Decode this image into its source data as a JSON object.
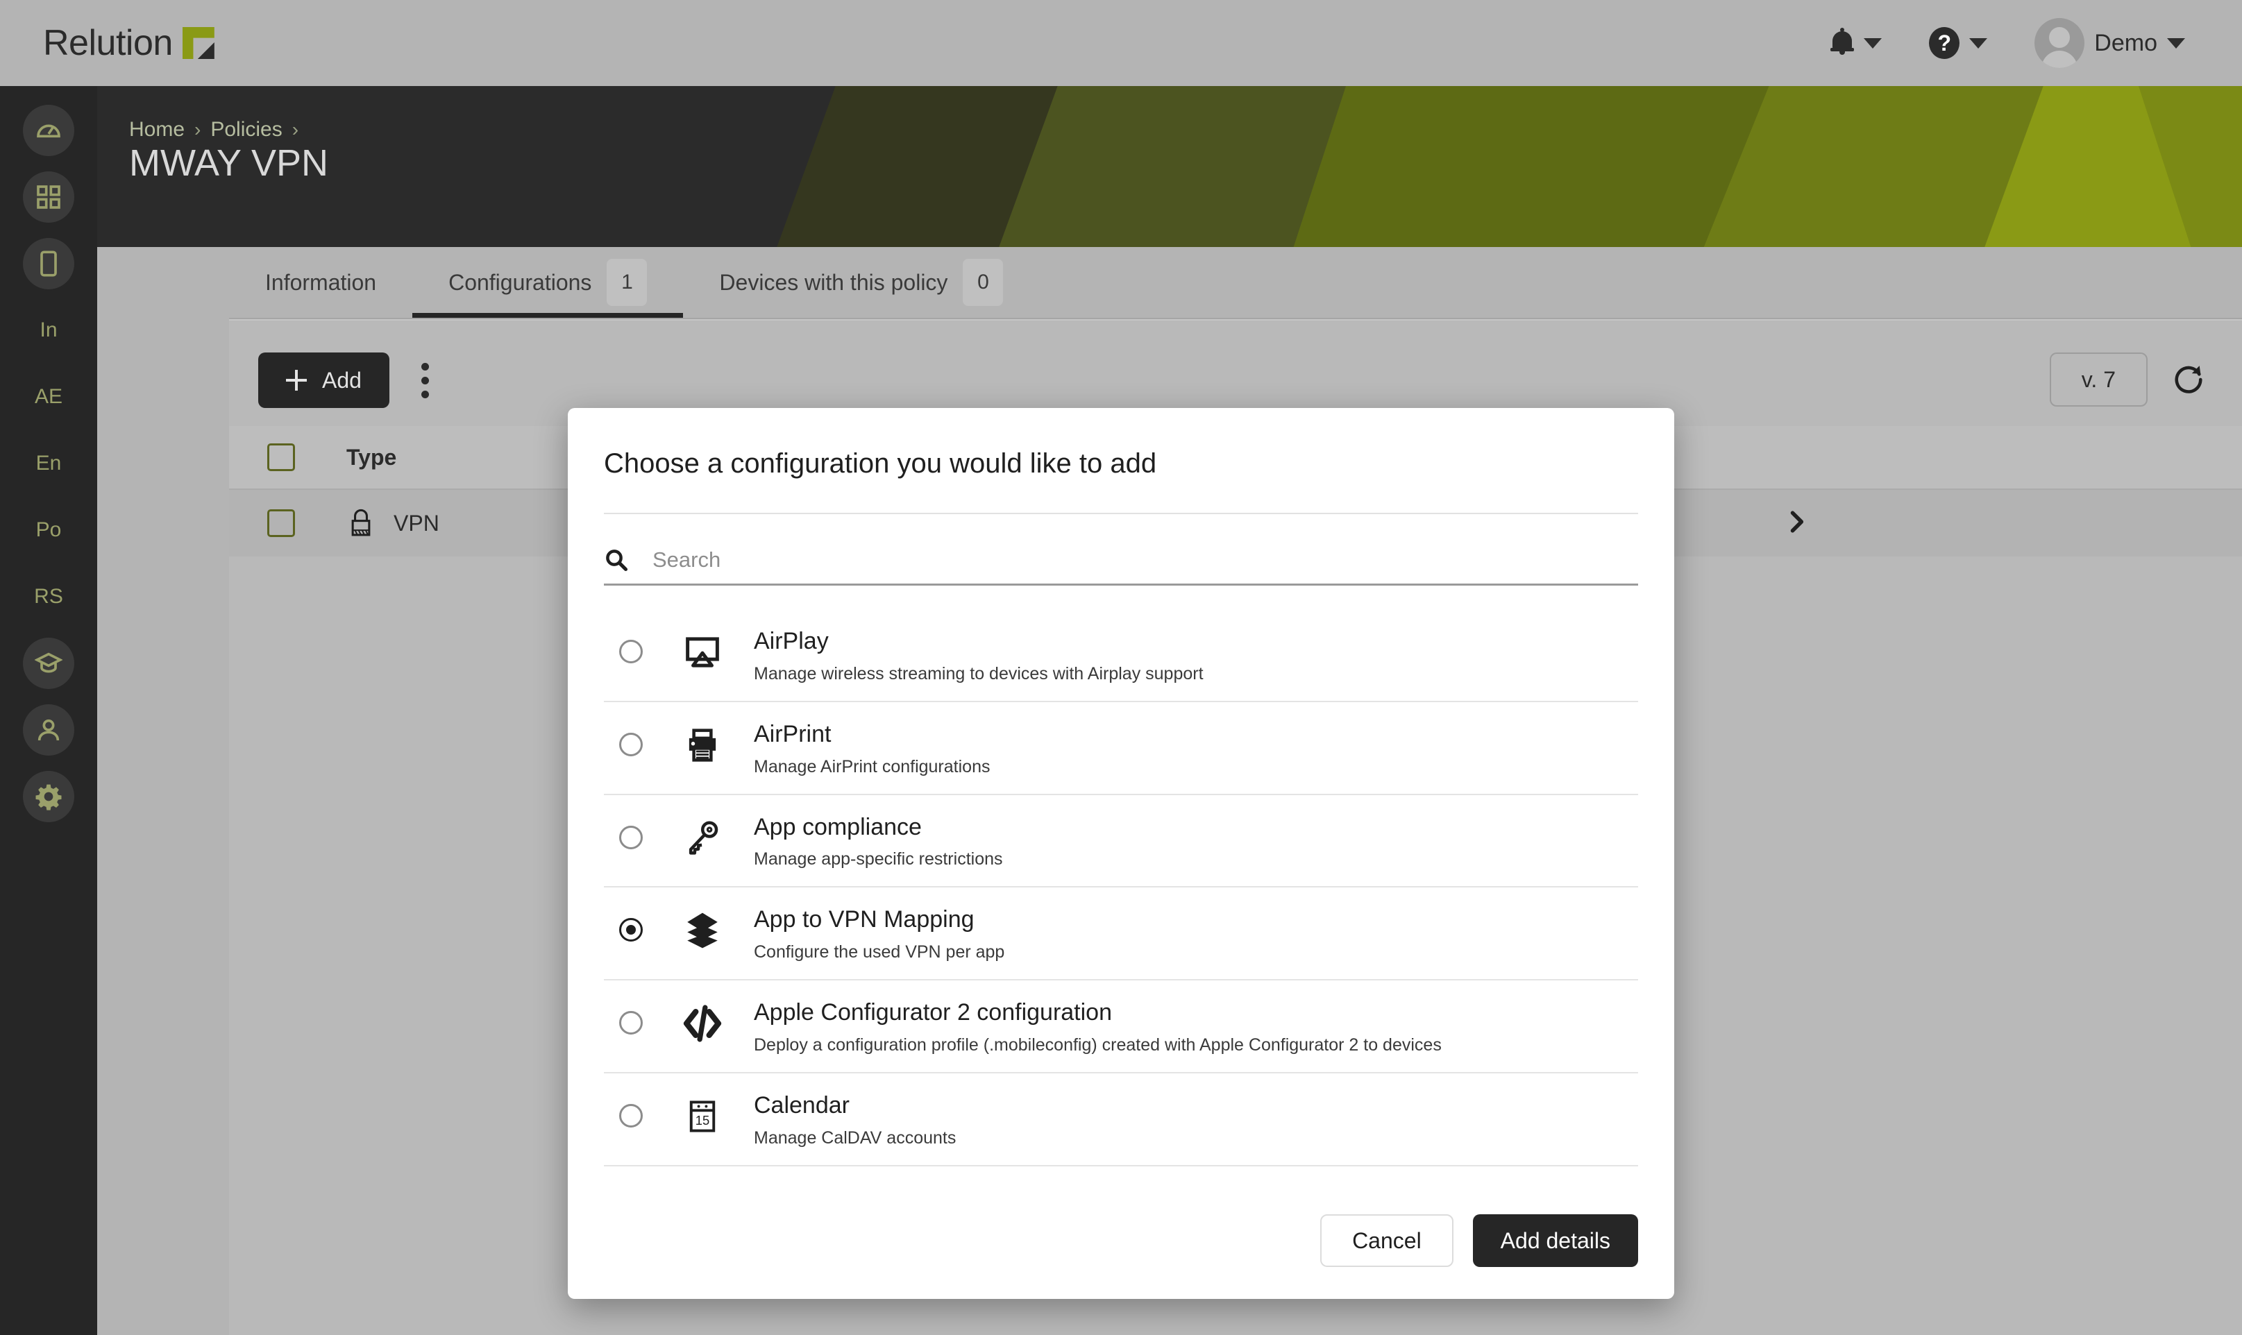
{
  "brand": {
    "name": "Relution",
    "accent_color": "#8a9a15",
    "dark_color": "#262626"
  },
  "topbar": {
    "notifications_icon": "bell-icon",
    "help_icon": "help-icon",
    "avatar_icon": "avatar",
    "user_name": "Demo",
    "chevron_icon": "chevron-down-icon"
  },
  "sidebar": {
    "items": [
      {
        "icon": "dashboard-gauge-icon",
        "label": "",
        "active": true
      },
      {
        "icon": "apps-grid-icon",
        "label": "",
        "active": true
      },
      {
        "icon": "device-tablet-icon",
        "label": "",
        "active": true
      },
      {
        "icon": "text-badge-icon",
        "label": "In",
        "active": false
      },
      {
        "icon": "text-badge-icon",
        "label": "AE",
        "active": false
      },
      {
        "icon": "text-badge-icon",
        "label": "En",
        "active": false
      },
      {
        "icon": "text-badge-icon",
        "label": "Po",
        "active": false
      },
      {
        "icon": "text-badge-icon",
        "label": "RS",
        "active": false
      },
      {
        "icon": "graduation-cap-icon",
        "label": "",
        "active": false
      },
      {
        "icon": "user-icon",
        "label": "",
        "active": false
      },
      {
        "icon": "gear-icon",
        "label": "",
        "active": true
      }
    ]
  },
  "breadcrumb": {
    "items": [
      "Home",
      "Policies"
    ],
    "separator": "›"
  },
  "page": {
    "title": "MWAY VPN"
  },
  "tabs": [
    {
      "label": "Information",
      "badge": null,
      "active": false
    },
    {
      "label": "Configurations",
      "badge": "1",
      "active": true
    },
    {
      "label": "Devices with this policy",
      "badge": "0",
      "active": false
    }
  ],
  "toolbar": {
    "add_label": "Add",
    "add_icon": "plus-icon",
    "more_icon": "kebab-menu-icon",
    "version_label": "v. 7",
    "refresh_icon": "refresh-icon"
  },
  "table": {
    "select_all_icon": "checkbox-icon",
    "columns": [
      "Type"
    ],
    "rows": [
      {
        "icon": "lock-icon",
        "type": "VPN",
        "expand_icon": "chevron-right-icon"
      }
    ]
  },
  "modal": {
    "title": "Choose a configuration you would like to add",
    "search": {
      "icon": "search-icon",
      "placeholder": "Search",
      "value": ""
    },
    "options": [
      {
        "name": "AirPlay",
        "description": "Manage wireless streaming to devices with Airplay support",
        "icon": "airplay-icon",
        "selected": false
      },
      {
        "name": "AirPrint",
        "description": "Manage AirPrint configurations",
        "icon": "printer-icon",
        "selected": false
      },
      {
        "name": "App compliance",
        "description": "Manage app-specific restrictions",
        "icon": "key-icon",
        "selected": false
      },
      {
        "name": "App to VPN Mapping",
        "description": "Configure the used VPN per app",
        "icon": "layers-icon",
        "selected": true
      },
      {
        "name": "Apple Configurator 2 configuration",
        "description": "Deploy a configuration profile (.mobileconfig) created with Apple Configurator 2 to devices",
        "icon": "code-brackets-icon",
        "selected": false
      },
      {
        "name": "Calendar",
        "description": "Manage CalDAV accounts",
        "icon": "calendar-icon",
        "calendar_day": "15",
        "selected": false
      }
    ],
    "footer": {
      "cancel_label": "Cancel",
      "submit_label": "Add details"
    },
    "scrollbar_color": "#5d6a14"
  }
}
